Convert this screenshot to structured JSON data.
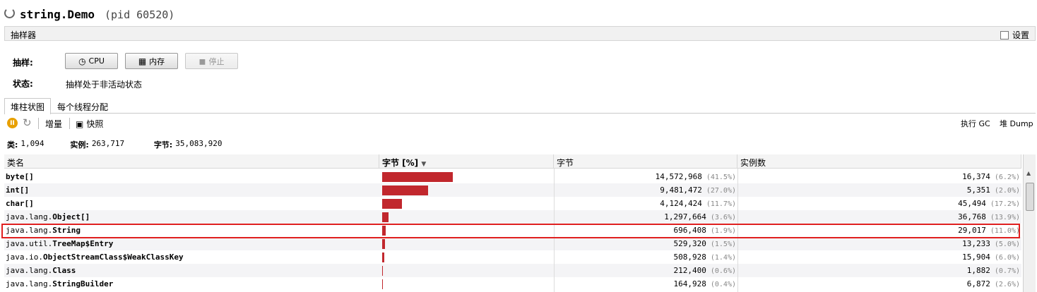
{
  "window": {
    "title": "string.Demo",
    "pid": "(pid 60520)"
  },
  "sampler": {
    "section_label": "抽样器",
    "settings_label": "设置",
    "sample_label": "抽样:",
    "cpu_label": "CPU",
    "memory_label": "内存",
    "stop_label": "停止",
    "status_label": "状态:",
    "status_value": "抽样处于非活动状态"
  },
  "tabs": [
    "堆柱状图",
    "每个线程分配"
  ],
  "toolbar": {
    "delta_label": "增量",
    "snapshot_label": "快照",
    "gc_label": "执行 GC",
    "heap_dump_label": "堆 Dump"
  },
  "stats": {
    "classes_label": "类:",
    "classes_value": "1,094",
    "instances_label": "实例:",
    "instances_value": "263,717",
    "bytes_label": "字节:",
    "bytes_value": "35,083,920"
  },
  "table": {
    "headers": [
      "类名",
      "字节 [%]",
      "字节",
      "实例数"
    ],
    "rows": [
      {
        "pkg": "",
        "cls": "byte[]",
        "bytes_pct": 41.5,
        "bytes": "14,572,968",
        "bytes_pct_text": "(41.5%)",
        "instances": "16,374",
        "inst_pct_text": "(6.2%)"
      },
      {
        "pkg": "",
        "cls": "int[]",
        "bytes_pct": 27.0,
        "bytes": "9,481,472",
        "bytes_pct_text": "(27.0%)",
        "instances": "5,351",
        "inst_pct_text": "(2.0%)"
      },
      {
        "pkg": "",
        "cls": "char[]",
        "bytes_pct": 11.7,
        "bytes": "4,124,424",
        "bytes_pct_text": "(11.7%)",
        "instances": "45,494",
        "inst_pct_text": "(17.2%)"
      },
      {
        "pkg": "java.lang.",
        "cls": "Object[]",
        "bytes_pct": 3.6,
        "bytes": "1,297,664",
        "bytes_pct_text": "(3.6%)",
        "instances": "36,768",
        "inst_pct_text": "(13.9%)"
      },
      {
        "pkg": "java.lang.",
        "cls": "String",
        "bytes_pct": 1.9,
        "bytes": "696,408",
        "bytes_pct_text": "(1.9%)",
        "instances": "29,017",
        "inst_pct_text": "(11.0%)"
      },
      {
        "pkg": "java.util.",
        "cls": "TreeMap$Entry",
        "bytes_pct": 1.5,
        "bytes": "529,320",
        "bytes_pct_text": "(1.5%)",
        "instances": "13,233",
        "inst_pct_text": "(5.0%)"
      },
      {
        "pkg": "java.io.",
        "cls": "ObjectStreamClass$WeakClassKey",
        "bytes_pct": 1.4,
        "bytes": "508,928",
        "bytes_pct_text": "(1.4%)",
        "instances": "15,904",
        "inst_pct_text": "(6.0%)"
      },
      {
        "pkg": "java.lang.",
        "cls": "Class",
        "bytes_pct": 0.6,
        "bytes": "212,400",
        "bytes_pct_text": "(0.6%)",
        "instances": "1,882",
        "inst_pct_text": "(0.7%)"
      },
      {
        "pkg": "java.lang.",
        "cls": "StringBuilder",
        "bytes_pct": 0.4,
        "bytes": "164,928",
        "bytes_pct_text": "(0.4%)",
        "instances": "6,872",
        "inst_pct_text": "(2.6%)"
      }
    ]
  },
  "colors": {
    "bar": "#c1272d",
    "highlight": "#e02020"
  },
  "icons": [
    "loading-spinner-icon",
    "clock-icon",
    "memory-chip-icon",
    "stop-icon",
    "pause-icon",
    "refresh-icon",
    "snapshot-icon",
    "sort-desc-icon"
  ]
}
